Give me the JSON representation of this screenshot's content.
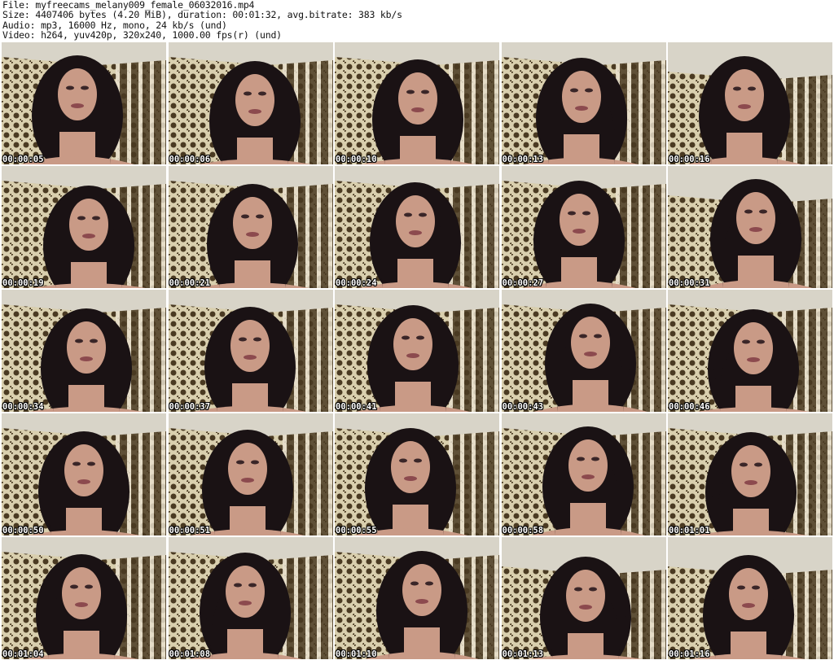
{
  "header": {
    "file_line": "File: myfreecams_melany009_female_06032016.mp4",
    "size_line": "Size: 4407406 bytes (4.20 MiB), duration: 00:01:32, avg.bitrate: 383 kb/s",
    "audio_line": "Audio: mp3, 16000 Hz, mono, 24 kb/s (und)",
    "video_line": "Video: h264, yuv420p, 320x240, 1000.00 fps(r) (und)"
  },
  "thumbnails": [
    {
      "timestamp": "00:00:05"
    },
    {
      "timestamp": "00:00:06"
    },
    {
      "timestamp": "00:00:10"
    },
    {
      "timestamp": "00:00:13"
    },
    {
      "timestamp": "00:00:16"
    },
    {
      "timestamp": "00:00:19"
    },
    {
      "timestamp": "00:00:21"
    },
    {
      "timestamp": "00:00:24"
    },
    {
      "timestamp": "00:00:27"
    },
    {
      "timestamp": "00:00:31"
    },
    {
      "timestamp": "00:00:34"
    },
    {
      "timestamp": "00:00:37"
    },
    {
      "timestamp": "00:00:41"
    },
    {
      "timestamp": "00:00:43"
    },
    {
      "timestamp": "00:00:46"
    },
    {
      "timestamp": "00:00:50"
    },
    {
      "timestamp": "00:00:51"
    },
    {
      "timestamp": "00:00:55"
    },
    {
      "timestamp": "00:00:58"
    },
    {
      "timestamp": "00:01:01"
    },
    {
      "timestamp": "00:01:04"
    },
    {
      "timestamp": "00:01:08"
    },
    {
      "timestamp": "00:01:10"
    },
    {
      "timestamp": "00:01:13"
    },
    {
      "timestamp": "00:01:16"
    }
  ],
  "colors": {
    "wall_light": "#d9cfae",
    "wall_pattern": "#4a3a22",
    "ceiling": "#d8d4c8",
    "hair": "#1a1214",
    "skin": "#c99a86",
    "stripe": "#e8e0cc"
  }
}
